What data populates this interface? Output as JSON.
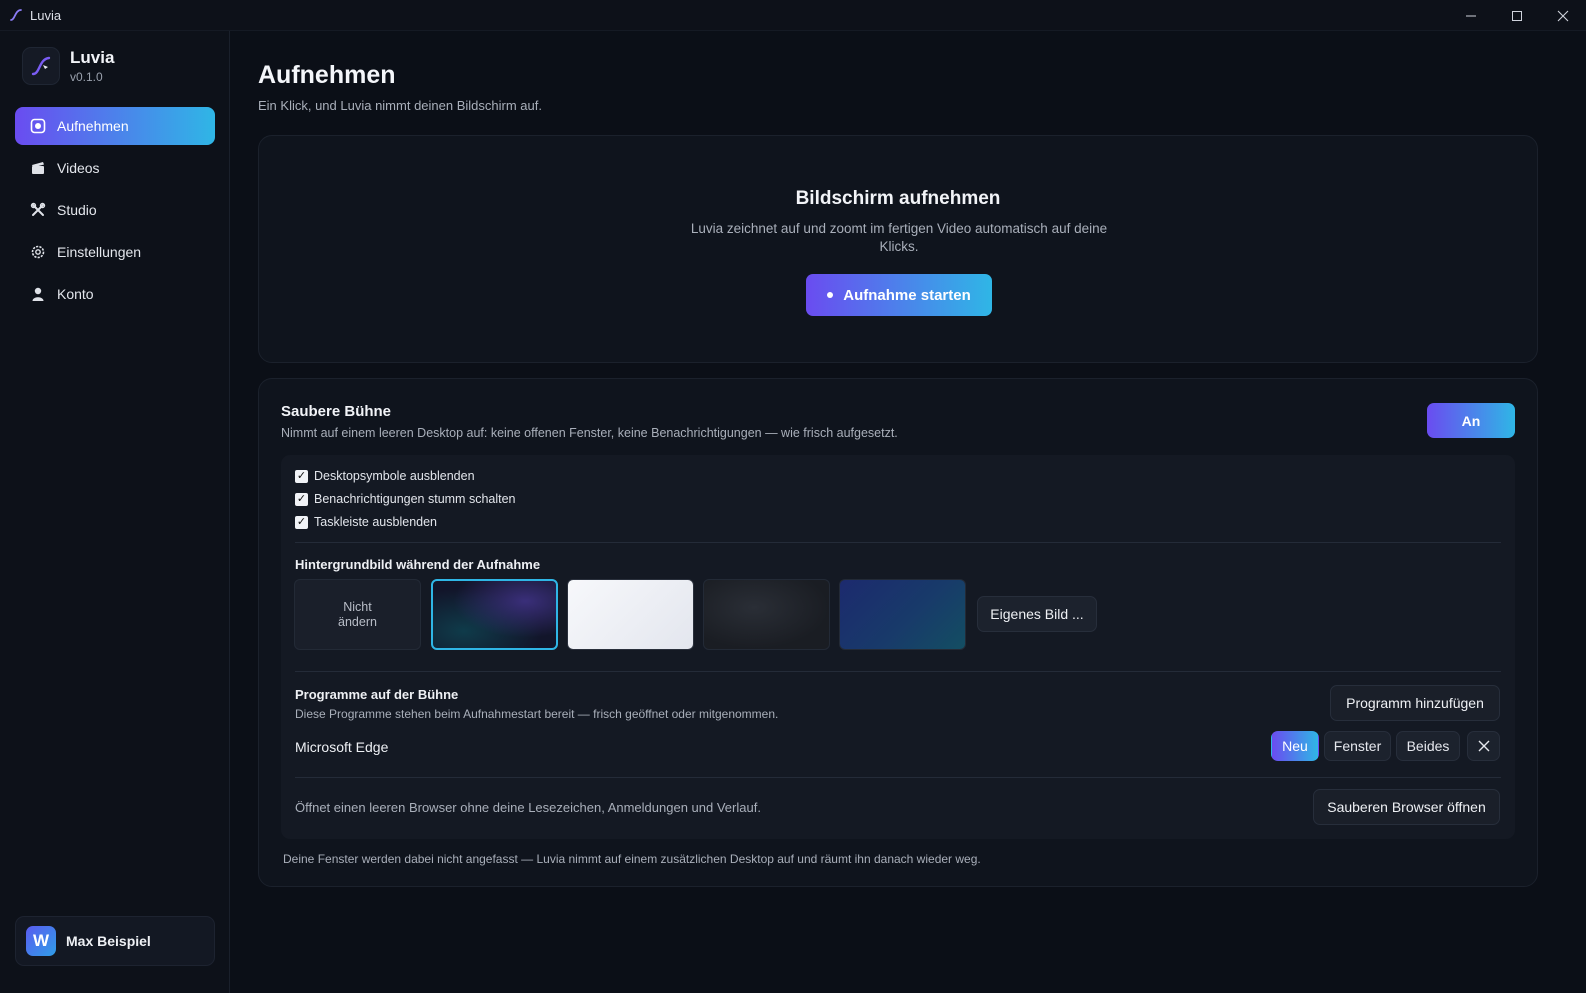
{
  "window": {
    "title": "Luvia"
  },
  "sidebar": {
    "app_name": "Luvia",
    "version": "v0.1.0",
    "items": [
      {
        "label": "Aufnehmen",
        "icon": "record-icon",
        "active": true
      },
      {
        "label": "Videos",
        "icon": "clapperboard-icon",
        "active": false
      },
      {
        "label": "Studio",
        "icon": "tools-icon",
        "active": false
      },
      {
        "label": "Einstellungen",
        "icon": "gear-icon",
        "active": false
      },
      {
        "label": "Konto",
        "icon": "user-icon",
        "active": false
      }
    ],
    "user": {
      "initial": "W",
      "name": "Max Beispiel"
    }
  },
  "page": {
    "title": "Aufnehmen",
    "subtitle": "Ein Klick, und Luvia nimmt deinen Bildschirm auf."
  },
  "hero": {
    "title": "Bildschirm aufnehmen",
    "description": "Luvia zeichnet auf und zoomt im fertigen Video automatisch auf deine Klicks.",
    "start_label": "Aufnahme starten"
  },
  "stage": {
    "title": "Saubere Bühne",
    "description": "Nimmt auf einem leeren Desktop auf: keine offenen Fenster, keine Benachrichtigungen — wie frisch aufgesetzt.",
    "toggle_label": "An",
    "options": [
      {
        "label": "Desktopsymbole ausblenden",
        "checked": true
      },
      {
        "label": "Benachrichtigungen stumm schalten",
        "checked": true
      },
      {
        "label": "Taskleiste ausblenden",
        "checked": true
      }
    ],
    "wallpaper": {
      "label": "Hintergrundbild während der Aufnahme",
      "none_label": "Nicht ändern",
      "selected_index": 1,
      "own_image_label": "Eigenes Bild ..."
    },
    "programs": {
      "label": "Programme auf der Bühne",
      "description": "Diese Programme stehen beim Aufnahmestart bereit — frisch geöffnet oder mitgenommen.",
      "add_label": "Programm hinzufügen",
      "items": [
        {
          "name": "Microsoft Edge",
          "modes": [
            "Neu",
            "Fenster",
            "Beides"
          ],
          "selected_mode": "Neu"
        }
      ]
    },
    "browser": {
      "description": "Öffnet einen leeren Browser ohne deine Lesezeichen, Anmeldungen und Verlauf.",
      "open_label": "Sauberen Browser öffnen"
    },
    "footer": "Deine Fenster werden dabei nicht angefasst — Luvia nimmt auf einem zusätzlichen Desktop auf und räumt ihn danach wieder weg."
  },
  "colors": {
    "accent_start": "#6a4cf0",
    "accent_end": "#2fb6e6",
    "background": "#0b0f17"
  }
}
